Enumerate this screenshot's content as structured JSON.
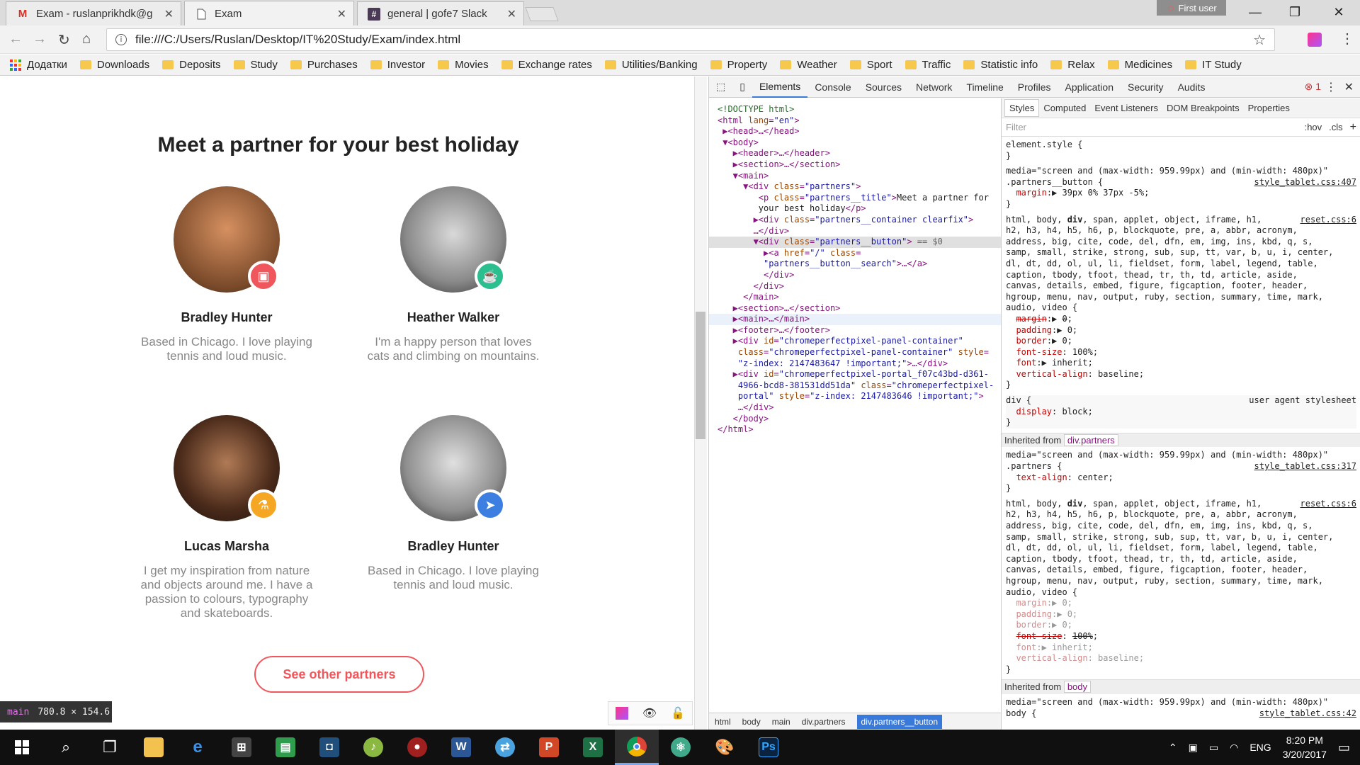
{
  "browser": {
    "tabs": [
      {
        "title": "Exam - ruslanprikhdk@g",
        "icon": "gmail-icon",
        "active": false
      },
      {
        "title": "Exam",
        "icon": "file-icon",
        "active": true
      },
      {
        "title": "general | gofe7 Slack",
        "icon": "slack-icon",
        "active": false
      }
    ],
    "profile_label": "First user",
    "url": "file:///C:/Users/Ruslan/Desktop/IT%20Study/Exam/index.html",
    "bookmarks": [
      "Додатки",
      "Downloads",
      "Deposits",
      "Study",
      "Purchases",
      "Investor",
      "Movies",
      "Exchange rates",
      "Utilities/Banking",
      "Property",
      "Weather",
      "Sport",
      "Traffic",
      "Statistic info",
      "Relax",
      "Medicines",
      "IT Study"
    ]
  },
  "page": {
    "title": "Meet a partner for your best holiday",
    "partners": [
      {
        "name": "Bradley Hunter",
        "desc": "Based in Chicago. I love playing tennis and loud music.",
        "badge_color": "#f0575c",
        "badge_icon": "tv-icon"
      },
      {
        "name": "Heather Walker",
        "desc": "I'm a happy person that loves cats and climbing on mountains.",
        "badge_color": "#2bbf8f",
        "badge_icon": "coffee-icon"
      },
      {
        "name": "Lucas Marsha",
        "desc": "I get my inspiration from nature and objects around me. I have a passion to colours, typography and skateboards.",
        "badge_color": "#f5a623",
        "badge_icon": "flask-icon"
      },
      {
        "name": "Bradley Hunter",
        "desc": "Based in Chicago. I love playing tennis and loud music.",
        "badge_color": "#3d7fe0",
        "badge_icon": "send-icon"
      }
    ],
    "button_label": "See other partners",
    "hover_tag": "main",
    "hover_size": "780.8 × 154.6"
  },
  "devtools": {
    "tabs": [
      "Elements",
      "Console",
      "Sources",
      "Network",
      "Timeline",
      "Profiles",
      "Application",
      "Security",
      "Audits"
    ],
    "error_count": "1",
    "breadcrumbs": [
      "html",
      "body",
      "main",
      "div.partners",
      "div.partners__button"
    ],
    "styles_tabs": [
      "Styles",
      "Computed",
      "Event Listeners",
      "DOM Breakpoints",
      "Properties"
    ],
    "filter_placeholder": "Filter",
    "filter_hov": ":hov",
    "filter_cls": ".cls",
    "inherited": [
      {
        "label": "Inherited from",
        "el": "div.partners"
      },
      {
        "label": "Inherited from",
        "el": "body"
      }
    ]
  },
  "taskbar": {
    "lang": "ENG",
    "time": "8:20 PM",
    "date": "3/20/2017"
  }
}
